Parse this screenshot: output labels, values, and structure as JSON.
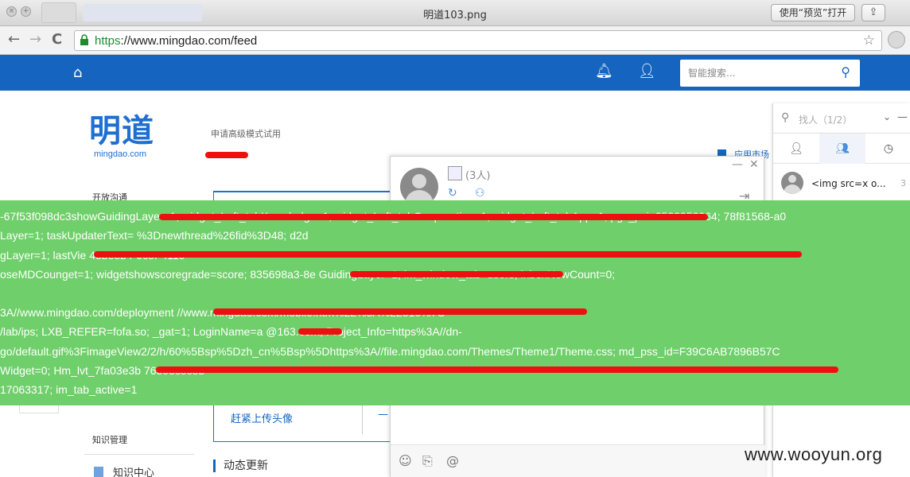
{
  "window": {
    "title": "明道103.png",
    "preview_button": "使用“预览”打开",
    "share_icon": "share-icon"
  },
  "browser": {
    "url_scheme": "https",
    "url_rest": "://www.mingdao.com/feed",
    "back": "←",
    "forward": "→",
    "reload": "C"
  },
  "sitenav": {
    "search_placeholder": "智能搜索...",
    "color": "#1565c0"
  },
  "page": {
    "logo_main": "明道",
    "logo_sub": "mingdao.com",
    "upgrade_text": "申请高级模式试用",
    "open_comm": "开放沟通",
    "apps_link": "应用市场",
    "upload_avatar": "赶紧上传头像",
    "knowledge_title": "知识管理",
    "knowledge_center": "知识中心",
    "feed_title": "动态更新"
  },
  "chat": {
    "member_count": "(3人)",
    "minimize": "—",
    "close": "✕"
  },
  "contacts": {
    "search_placeholder": "找人（1/2）",
    "first_contact": "<img src=x o...",
    "first_contact_badge": "3"
  },
  "alert": {
    "lines": [
      "-67f53f098dc3showGuidingLayer=1; widget_Left_tabKonwladge=1; widget_Left_tabCooperation=1; widget_Left_tabApp=1; pgv_pvi=2532952064; 78f81568-a0",
      "Layer=1; taskUpdaterText=                                                                                                                   %3Dnewthread%26fid%3D48; d2d",
      "gLayer=1; lastVie                                                                                                                               43be8b4-9c8f-411c",
      "oseMDCounget=1; widgetshowscoregrade=score; 835698a3-8e                                              GuidingLayer=1; im_window_tab=users; inboxNewCount=0; ",
      "",
      "3A//www.mingdao.com/deployment                                                                                  //www.mingdao.com/mobile.htm%22%3A%22310%7C",
      "/lab/ips; LXB_REFER=fofa.so; _gat=1; LoginName=a              @163.com; Project_Info=https%3A//dn-",
      "go/default.gif%3FimageView2/2/h/60%5Bsp%5Dzh_cn%5Bsp%5Dhttps%3A//file.mingdao.com/Themes/Theme1/Theme.css; md_pss_id=F39C6AB7896B57C",
      "Widget=0; Hm_lvt_7fa03e3b                                                                                                                                   76503c5c5b=",
      "17063317; im_tab_active=1"
    ],
    "color": "#6fcf6a"
  },
  "watermark": "www.wooyun.org",
  "redaction_color": "#ee1010"
}
